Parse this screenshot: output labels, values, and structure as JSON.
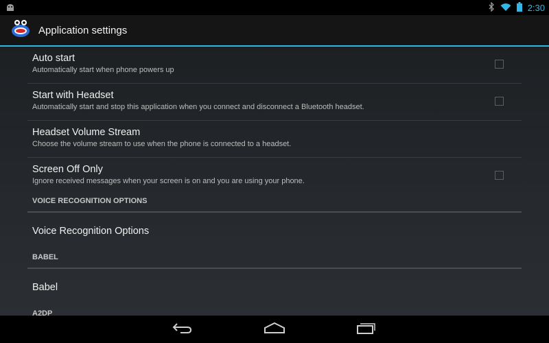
{
  "status_bar": {
    "time": "2:30",
    "icons": [
      "android-debug-icon",
      "bluetooth-icon",
      "wifi-icon",
      "battery-icon"
    ]
  },
  "action_bar": {
    "title": "Application settings",
    "app_icon": "app-logo-icon"
  },
  "preferences": [
    {
      "title": "Auto start",
      "summary": "Automatically start when phone powers up",
      "has_checkbox": true,
      "checked": false
    },
    {
      "title": "Start with Headset",
      "summary": "Automatically start and stop this application when you connect and disconnect a Bluetooth headset.",
      "has_checkbox": true,
      "checked": false
    },
    {
      "title": "Headset Volume Stream",
      "summary": "Choose the volume stream to use when the phone is connected to a headset.",
      "has_checkbox": false
    },
    {
      "title": "Screen Off Only",
      "summary": "Ignore received messages when your screen is on and you are using your phone.",
      "has_checkbox": true,
      "checked": false
    }
  ],
  "categories": [
    {
      "header": "VOICE RECOGNITION OPTIONS",
      "item": "Voice Recognition Options"
    },
    {
      "header": "BABEL",
      "item": "Babel"
    },
    {
      "header": "A2DP"
    }
  ],
  "nav_bar": {
    "icons": [
      "back-icon",
      "home-icon",
      "recent-apps-icon"
    ]
  },
  "colors": {
    "accent": "#33b5e5",
    "background": "#000000",
    "content_bg": "#262a2e"
  }
}
